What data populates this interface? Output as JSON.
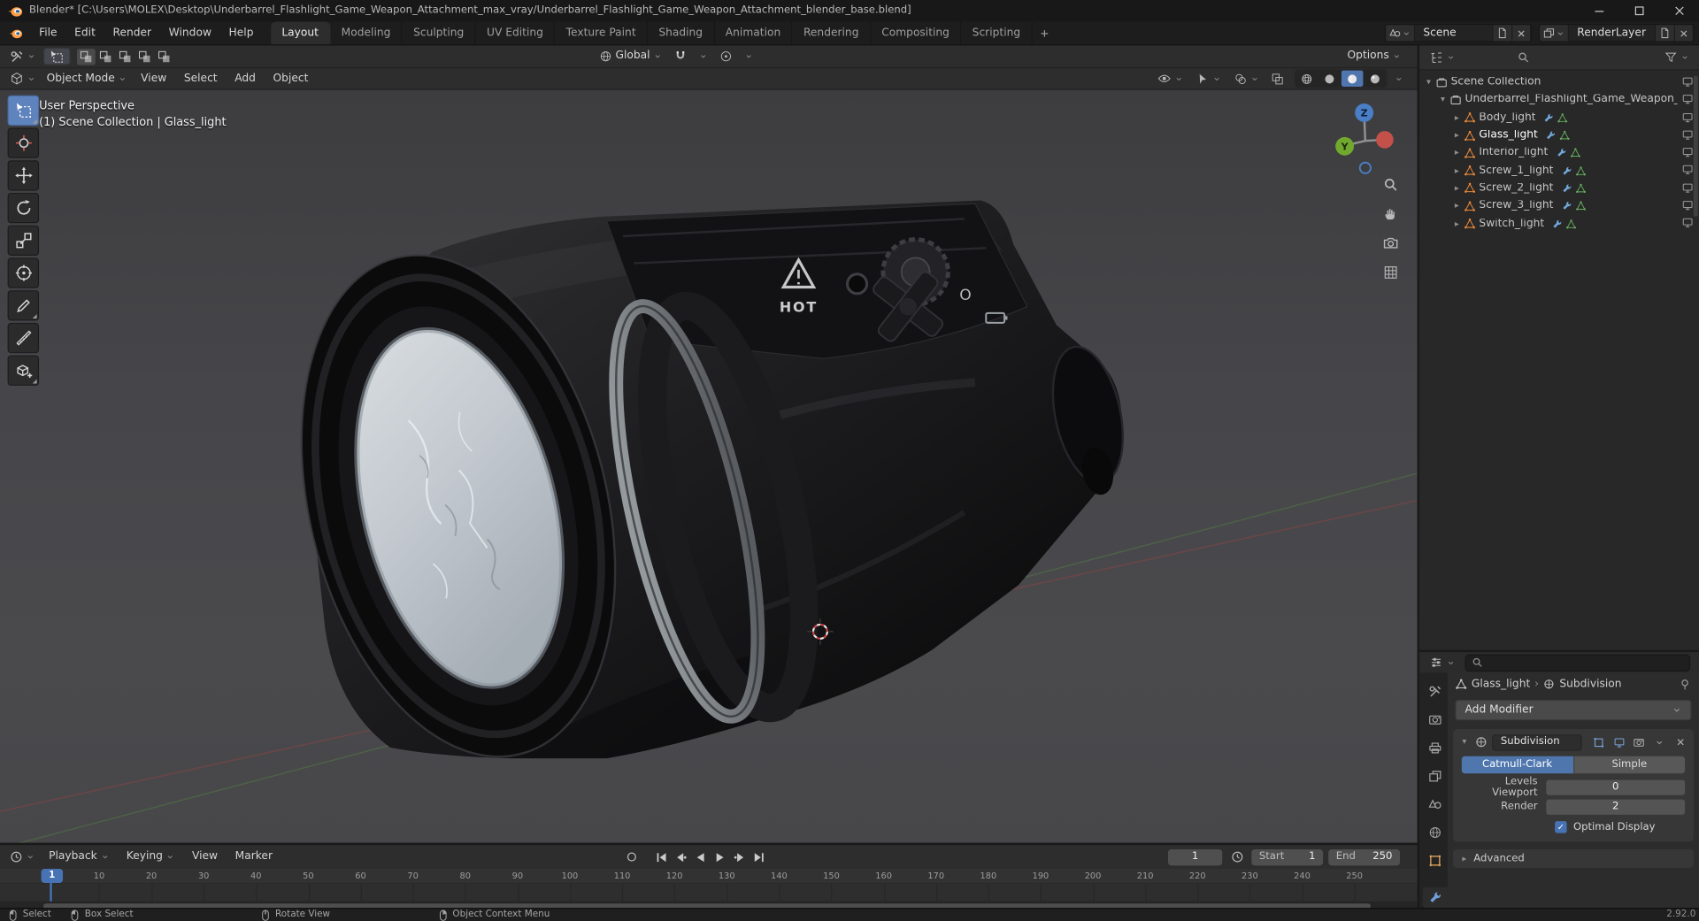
{
  "window": {
    "title": "Blender* [C:\\Users\\MOLEX\\Desktop\\Underbarrel_Flashlight_Game_Weapon_Attachment_max_vray/Underbarrel_Flashlight_Game_Weapon_Attachment_blender_base.blend]"
  },
  "topbar": {
    "menus": [
      "File",
      "Edit",
      "Render",
      "Window",
      "Help"
    ],
    "workspaces": [
      "Layout",
      "Modeling",
      "Sculpting",
      "UV Editing",
      "Texture Paint",
      "Shading",
      "Animation",
      "Rendering",
      "Compositing",
      "Scripting"
    ],
    "active_workspace": "Layout",
    "scene_name": "Scene",
    "view_layer_name": "RenderLayer"
  },
  "tool_header": {
    "orientation": "Global",
    "options_label": "Options"
  },
  "viewport_header": {
    "mode": "Object Mode",
    "menus": [
      "View",
      "Select",
      "Add",
      "Object"
    ],
    "active_shading": "Material Preview"
  },
  "toolbar": {
    "tools": [
      "Select Box",
      "Cursor",
      "Move",
      "Rotate",
      "Scale",
      "Transform",
      "Annotate",
      "Measure",
      "Add Cube"
    ],
    "active_tool": "Select Box"
  },
  "viewport": {
    "view_label": "User Perspective",
    "context_label": "(1) Scene Collection | Glass_light",
    "gizmo_axes": [
      "Z",
      "Y"
    ],
    "model_markings": {
      "hot": "HOT",
      "o": "O"
    }
  },
  "outliner": {
    "rows": [
      {
        "label": "Scene Collection",
        "type": "collection",
        "level": 0,
        "expanded": true
      },
      {
        "label": "Underbarrel_Flashlight_Game_Weapon_Atta",
        "type": "collection",
        "level": 1,
        "expanded": true
      },
      {
        "label": "Body_light",
        "type": "mesh",
        "level": 2
      },
      {
        "label": "Glass_light",
        "type": "mesh",
        "level": 2,
        "active": true
      },
      {
        "label": "Interior_light",
        "type": "mesh",
        "level": 2
      },
      {
        "label": "Screw_1_light",
        "type": "mesh",
        "level": 2
      },
      {
        "label": "Screw_2_light",
        "type": "mesh",
        "level": 2
      },
      {
        "label": "Screw_3_light",
        "type": "mesh",
        "level": 2
      },
      {
        "label": "Switch_light",
        "type": "mesh",
        "level": 2
      }
    ]
  },
  "properties": {
    "tabs": [
      "Tool",
      "Render",
      "Output",
      "View Layer",
      "Scene",
      "World",
      "Object",
      "Modifiers"
    ],
    "active_tab": "Modifiers",
    "breadcrumb": {
      "object": "Glass_light",
      "modifier": "Subdivision"
    },
    "add_modifier_label": "Add Modifier",
    "modifier": {
      "name": "Subdivision",
      "algorithms": [
        "Catmull-Clark",
        "Simple"
      ],
      "active_algorithm": "Catmull-Clark",
      "fields": [
        {
          "label": "Levels Viewport",
          "value": "0"
        },
        {
          "label": "Render",
          "value": "2"
        }
      ],
      "optimal_display_label": "Optimal Display",
      "optimal_display_checked": true,
      "advanced_label": "Advanced"
    }
  },
  "timeline": {
    "menus": [
      {
        "label": "Playback",
        "dropdown": true
      },
      {
        "label": "Keying",
        "dropdown": true
      },
      {
        "label": "View",
        "dropdown": false
      },
      {
        "label": "Marker",
        "dropdown": false
      }
    ],
    "playback_buttons": [
      "jump-to-start",
      "jump-to-prev-keyframe",
      "play-reverse",
      "play",
      "jump-to-next-keyframe",
      "jump-to-end"
    ],
    "current_frame": "1",
    "start_label": "Start",
    "start_frame": "1",
    "end_label": "End",
    "end_frame": "250",
    "frame_ticks": [
      1,
      10,
      20,
      30,
      40,
      50,
      60,
      70,
      80,
      90,
      100,
      110,
      120,
      130,
      140,
      150,
      160,
      170,
      180,
      190,
      200,
      210,
      220,
      230,
      240,
      250
    ]
  },
  "statusbar": {
    "hints": [
      {
        "mouse": "left",
        "label": "Select"
      },
      {
        "mouse": "left",
        "label": "Box Select"
      },
      {
        "mouse": "middle",
        "label": "Rotate View"
      },
      {
        "mouse": "right",
        "label": "Object Context Menu"
      }
    ],
    "version": "2.92.0"
  },
  "colors": {
    "accent": "#4772b3",
    "selected_tool": "#5f83bd",
    "mesh_icon_orange": "#e8883a",
    "modifier_icon_blue": "#71a8dc",
    "mesh_data_green": "#67b05f",
    "axis_x": "#c4504a",
    "axis_y": "#71a92f",
    "axis_z": "#4a7fc7"
  }
}
